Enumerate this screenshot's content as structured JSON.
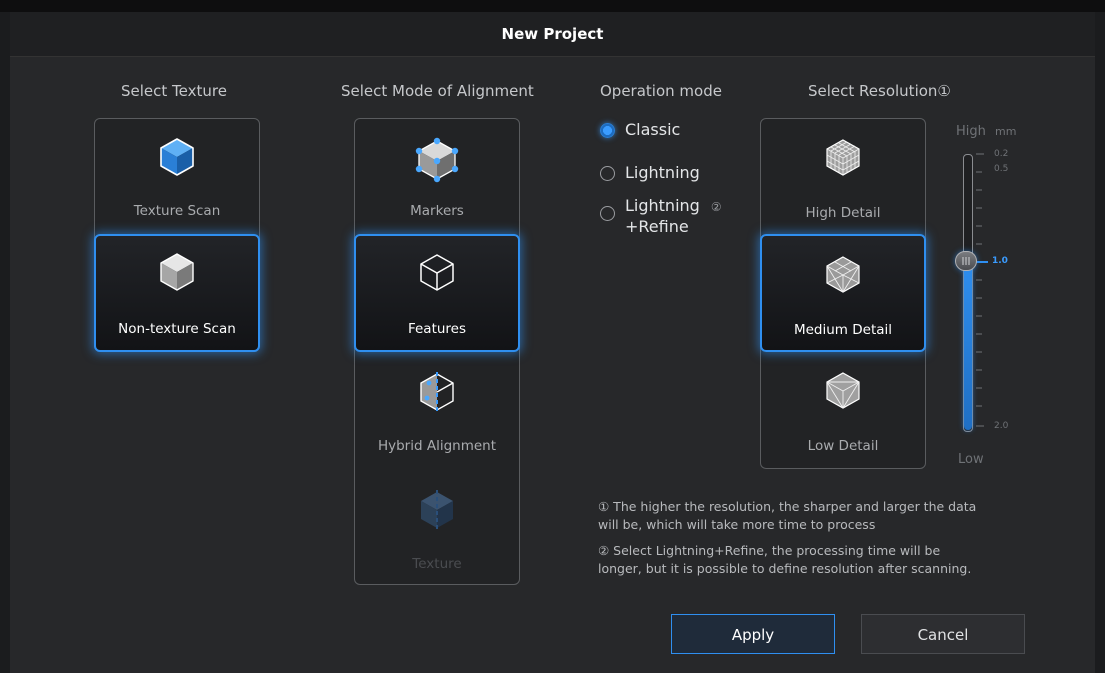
{
  "dialog": {
    "title": "New Project"
  },
  "texture": {
    "heading": "Select Texture",
    "options": [
      {
        "label": "Texture Scan",
        "icon": "blue-cube-icon",
        "selected": false
      },
      {
        "label": "Non-texture Scan",
        "icon": "gray-cube-icon",
        "selected": true
      }
    ]
  },
  "alignment": {
    "heading": "Select Mode of Alignment",
    "options": [
      {
        "label": "Markers",
        "icon": "cube-markers-icon",
        "selected": false
      },
      {
        "label": "Features",
        "icon": "cube-outline-icon",
        "selected": true
      },
      {
        "label": "Hybrid Alignment",
        "icon": "cube-hybrid-icon",
        "selected": false
      },
      {
        "label": "Texture",
        "icon": "cube-texture-icon",
        "selected": false,
        "disabled": true
      }
    ]
  },
  "operation": {
    "heading": "Operation mode",
    "options": [
      {
        "label": "Classic",
        "selected": true
      },
      {
        "label": "Lightning",
        "selected": false
      },
      {
        "label_line1": "Lightning",
        "label_line2": "+Refine",
        "marker": "②",
        "selected": false
      }
    ]
  },
  "resolution": {
    "heading": "Select Resolution①",
    "options": [
      {
        "label": "High Detail",
        "icon": "mesh-cube-dense-icon",
        "selected": false
      },
      {
        "label": "Medium Detail",
        "icon": "mesh-cube-medium-icon",
        "selected": true
      },
      {
        "label": "Low Detail",
        "icon": "mesh-cube-sparse-icon",
        "selected": false
      }
    ],
    "slider": {
      "high_label": "High",
      "unit": "mm",
      "low_label": "Low",
      "ticks": [
        "0.2",
        "0.5",
        "1.0",
        "2.0"
      ],
      "value": "1.0",
      "min": 0.2,
      "max": 2.0
    }
  },
  "notes": {
    "note1_line1": "① The higher the resolution, the sharper and larger the data",
    "note1_line2": "will be, which will take more time to process",
    "note2_line1": "② Select Lightning+Refine, the processing time will be",
    "note2_line2": "longer, but it is possible to define resolution after scanning."
  },
  "buttons": {
    "apply": "Apply",
    "cancel": "Cancel"
  },
  "colors": {
    "accent": "#2f8ff0",
    "background": "#27282a"
  }
}
